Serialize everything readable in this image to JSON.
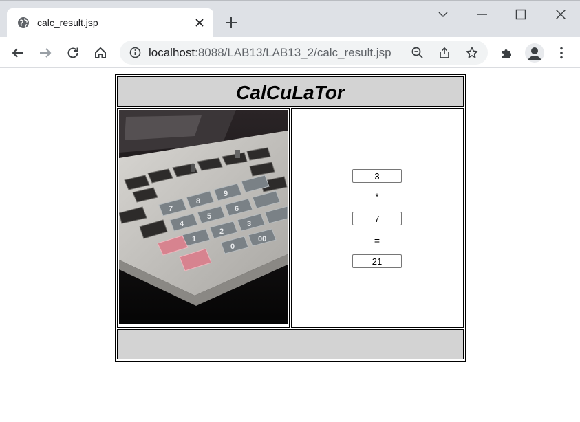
{
  "browser": {
    "tab_title": "calc_result.jsp",
    "url_host": "localhost",
    "url_rest": ":8088/LAB13/LAB13_2/calc_result.jsp"
  },
  "page": {
    "title": "CalCuLaTor",
    "operand1": "3",
    "operator": "*",
    "operand2": "7",
    "equals": "=",
    "result": "21"
  },
  "icons": {
    "tab_favicon": "globe-icon",
    "tab_close": "close-icon",
    "new_tab": "plus-icon",
    "back": "arrow-left-icon",
    "forward": "arrow-right-icon",
    "reload": "reload-icon",
    "home": "home-icon",
    "site_info": "info-icon",
    "zoom": "zoom-out-icon",
    "share": "share-icon",
    "bookmark": "star-icon",
    "extensions": "puzzle-icon",
    "profile": "person-icon",
    "menu": "kebab-menu-icon"
  },
  "colors": {
    "title_bg": "#d3d3d3",
    "tabstrip_bg": "#dee1e6",
    "omnibox_bg": "#f1f3f4"
  }
}
